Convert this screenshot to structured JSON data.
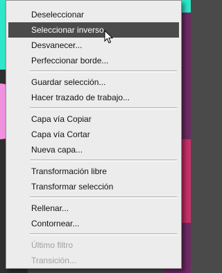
{
  "menu": {
    "groups": [
      [
        {
          "label": "Deseleccionar",
          "state": "normal"
        },
        {
          "label": "Seleccionar inverso",
          "state": "highlighted"
        },
        {
          "label": "Desvanecer...",
          "state": "normal"
        },
        {
          "label": "Perfeccionar borde...",
          "state": "normal"
        }
      ],
      [
        {
          "label": "Guardar selección...",
          "state": "normal"
        },
        {
          "label": "Hacer trazado de trabajo...",
          "state": "normal"
        }
      ],
      [
        {
          "label": "Capa vía Copiar",
          "state": "normal"
        },
        {
          "label": "Capa vía Cortar",
          "state": "normal"
        },
        {
          "label": "Nueva capa...",
          "state": "normal"
        }
      ],
      [
        {
          "label": "Transformación libre",
          "state": "normal"
        },
        {
          "label": "Transformar selección",
          "state": "normal"
        }
      ],
      [
        {
          "label": "Rellenar...",
          "state": "normal"
        },
        {
          "label": "Contornear...",
          "state": "normal"
        }
      ],
      [
        {
          "label": "Último filtro",
          "state": "disabled"
        },
        {
          "label": "Transición...",
          "state": "disabled"
        }
      ]
    ]
  },
  "colors": {
    "highlight": "#4b4b4b",
    "menu_bg": "#ececec",
    "disabled_text": "#a0a0a0"
  }
}
